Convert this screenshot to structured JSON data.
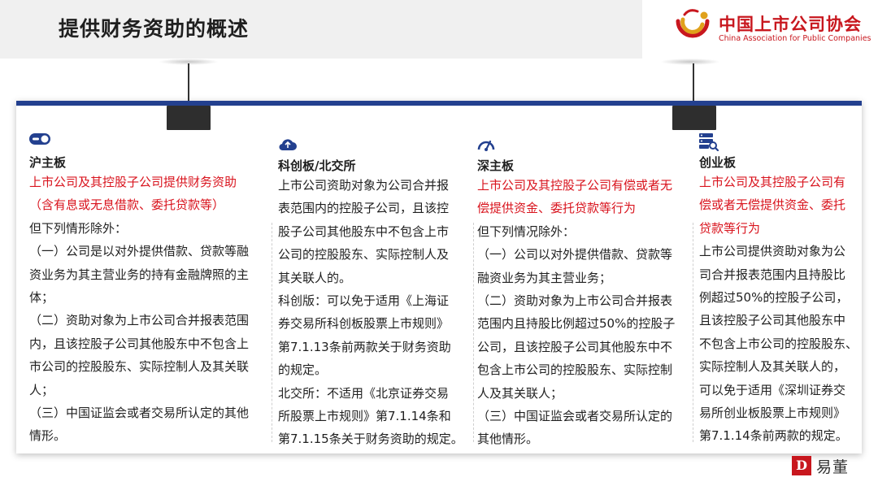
{
  "title": "提供财务资助的概述",
  "logo": {
    "cn": "中国上市公司协会",
    "en": "China Association for Public Companies"
  },
  "columns": [
    {
      "icon": "toggle-icon",
      "title": "沪主板",
      "lines": [
        {
          "text": "上市公司及其控股子公司提供财务资助",
          "red": true
        },
        {
          "text": "（含有息或无息借款、委托贷款等）",
          "red": true
        },
        {
          "text": "但下列情形除外：",
          "red": false
        },
        {
          "text": "（一）公司是以对外提供借款、贷款等融",
          "red": false
        },
        {
          "text": "资业务为其主营业务的持有金融牌照的主",
          "red": false
        },
        {
          "text": "体；",
          "red": false
        },
        {
          "text": "（二）资助对象为上市公司合并报表范围",
          "red": false
        },
        {
          "text": "内，且该控股子公司其他股东中不包含上",
          "red": false
        },
        {
          "text": "市公司的控股股东、实际控制人及其关联",
          "red": false
        },
        {
          "text": "人；",
          "red": false
        },
        {
          "text": "（三）中国证监会或者交易所认定的其他",
          "red": false
        },
        {
          "text": "情形。",
          "red": false
        }
      ]
    },
    {
      "icon": "cloud-upload-icon",
      "title": "科创板/北交所",
      "lines": [
        {
          "text": "上市公司资助对象为公司合并报",
          "red": false
        },
        {
          "text": "表范围内的控股子公司，且该控",
          "red": false
        },
        {
          "text": "股子公司其他股东中不包含上市",
          "red": false
        },
        {
          "text": "公司的控股股东、实际控制人及",
          "red": false
        },
        {
          "text": "其关联人的。",
          "red": false
        },
        {
          "text": "科创版：可以免于适用《上海证",
          "red": false
        },
        {
          "text": "券交易所科创板股票上市规则》",
          "red": false
        },
        {
          "text": "第7.1.13条前两款关于财务资助",
          "red": false
        },
        {
          "text": "的规定。",
          "red": false
        },
        {
          "text": "北交所：不适用《北京证券交易",
          "red": false
        },
        {
          "text": "所股票上市规则》第7.1.14条和",
          "red": false
        },
        {
          "text": "第7.1.15条关于财务资助的规定。",
          "red": false
        }
      ]
    },
    {
      "icon": "gauge-icon",
      "title": "深主板",
      "lines": [
        {
          "text": "上市公司及其控股子公司有偿或者无",
          "red": true
        },
        {
          "text": "偿提供资金、委托贷款等行为",
          "red": true
        },
        {
          "text": "但下列情况除外：",
          "red": false
        },
        {
          "text": "（一）公司以对外提供借款、贷款等",
          "red": false
        },
        {
          "text": "融资业务为其主营业务；",
          "red": false
        },
        {
          "text": "（二）资助对象为上市公司合并报表",
          "red": false
        },
        {
          "text": "范围内且持股比例超过50%的控股子",
          "red": false
        },
        {
          "text": "公司，且该控股子公司其他股东中不",
          "red": false
        },
        {
          "text": "包含上市公司的控股股东、实际控制",
          "red": false
        },
        {
          "text": "人及其关联人；",
          "red": false
        },
        {
          "text": "（三）中国证监会或者交易所认定的",
          "red": false
        },
        {
          "text": "其他情形。",
          "red": false
        }
      ]
    },
    {
      "icon": "server-search-icon",
      "title": "创业板",
      "lines": [
        {
          "text": "上市公司及其控股子公司有",
          "red": true
        },
        {
          "text": "偿或者无偿提供资金、委托",
          "red": true
        },
        {
          "text": "贷款等行为",
          "red": true
        },
        {
          "text": "上市公司提供资助对象为公",
          "red": false
        },
        {
          "text": "司合并报表范围内且持股比",
          "red": false
        },
        {
          "text": "例超过50%的控股子公司，",
          "red": false
        },
        {
          "text": "且该控股子公司其他股东中",
          "red": false
        },
        {
          "text": "不包含上市公司的控股股东、",
          "red": false
        },
        {
          "text": "实际控制人及其关联人的，",
          "red": false
        },
        {
          "text": "可以免于适用《深圳证券交",
          "red": false
        },
        {
          "text": "易所创业板股票上市规则》",
          "red": false
        },
        {
          "text": "第7.1.14条前两款的规定。",
          "red": false
        }
      ]
    }
  ],
  "brand": {
    "name": "易董",
    "mark": "D"
  },
  "colors": {
    "accent_blue": "#23408f",
    "emphasis_red": "#d9141e",
    "logo_red": "#c8171e"
  }
}
